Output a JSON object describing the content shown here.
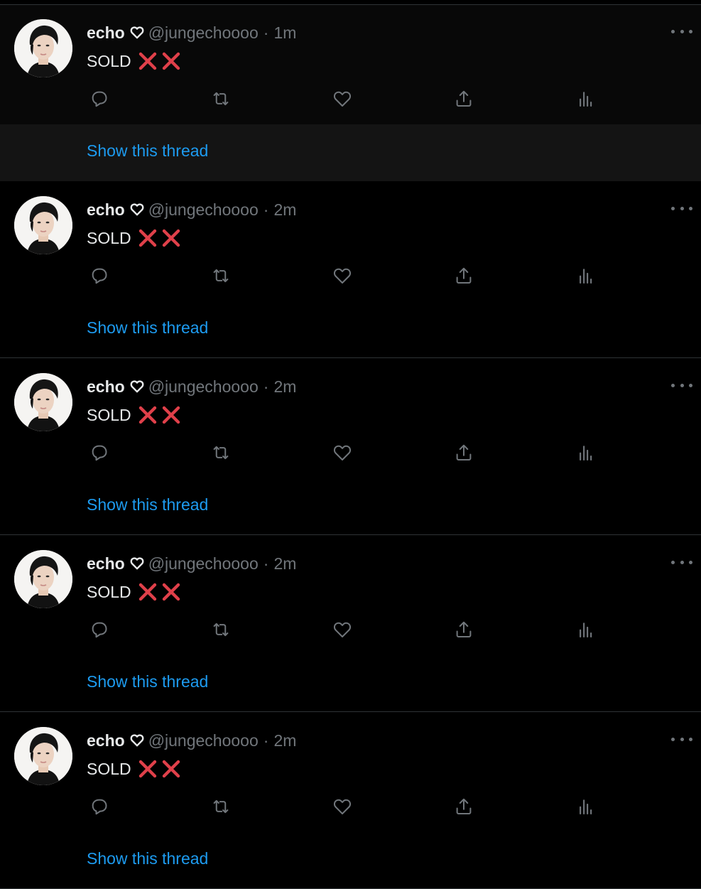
{
  "colors": {
    "background": "#000000",
    "divider": "#2f3336",
    "primary_text": "#e7e9ea",
    "secondary_text": "#71767b",
    "link": "#1d9bf0",
    "cross_mark": "#e0404a"
  },
  "icons": {
    "name_emoji": "white-heart-icon",
    "text_emoji": "cross-mark-icon",
    "actions": [
      "reply-icon",
      "retweet-icon",
      "like-icon",
      "share-icon",
      "analytics-icon"
    ],
    "more": "more-options-icon"
  },
  "tweets": [
    {
      "name": "echo",
      "handle": "@jungechoooo",
      "separator": "·",
      "time": "1m",
      "text": "SOLD",
      "thread_label": "Show this thread"
    },
    {
      "name": "echo",
      "handle": "@jungechoooo",
      "separator": "·",
      "time": "2m",
      "text": "SOLD",
      "thread_label": "Show this thread"
    },
    {
      "name": "echo",
      "handle": "@jungechoooo",
      "separator": "·",
      "time": "2m",
      "text": "SOLD",
      "thread_label": "Show this thread"
    },
    {
      "name": "echo",
      "handle": "@jungechoooo",
      "separator": "·",
      "time": "2m",
      "text": "SOLD",
      "thread_label": "Show this thread"
    },
    {
      "name": "echo",
      "handle": "@jungechoooo",
      "separator": "·",
      "time": "2m",
      "text": "SOLD",
      "thread_label": "Show this thread"
    }
  ]
}
